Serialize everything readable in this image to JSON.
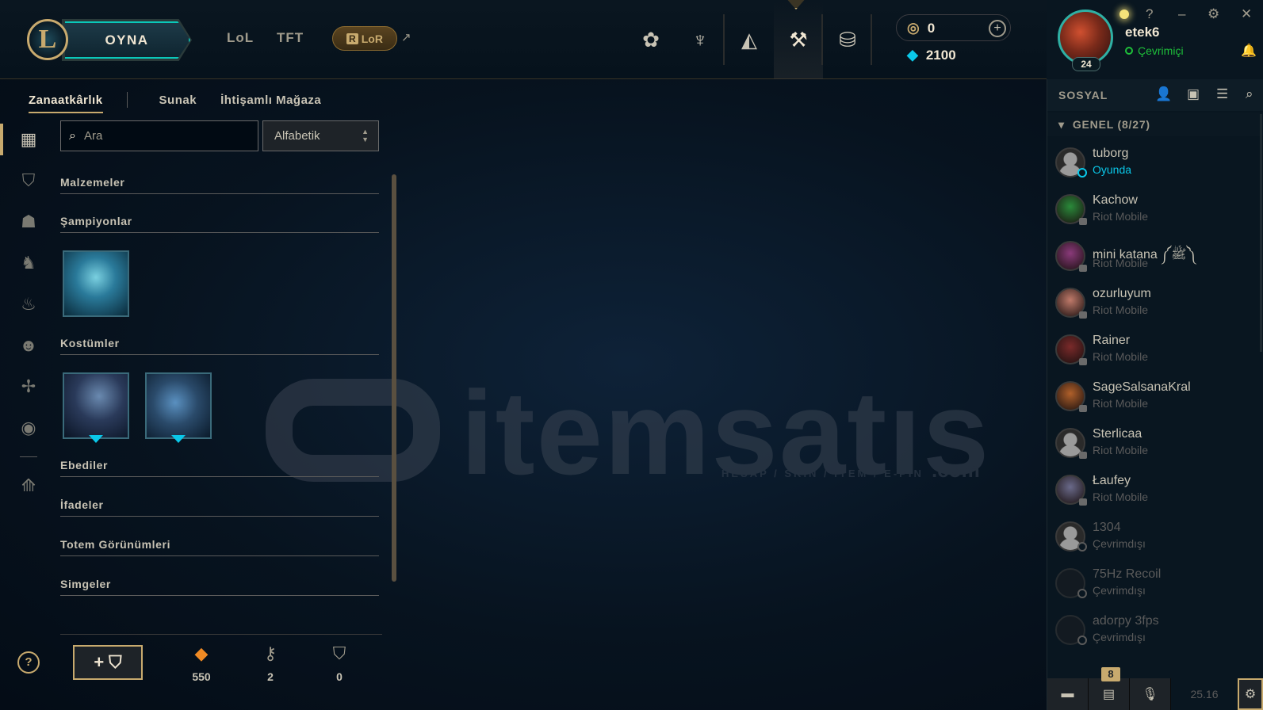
{
  "topnav": {
    "logo": "L",
    "play_label": "OYNA",
    "tabs": [
      "LoL",
      "TFT"
    ],
    "lor_label": "LoR",
    "lor_r": "R",
    "external_arrow": "↗",
    "nav_icons": [
      {
        "name": "home-icon",
        "glyph": "✿"
      },
      {
        "name": "tft-icon",
        "glyph": "♆"
      },
      {
        "name": "collection-icon",
        "glyph": "◭"
      },
      {
        "name": "loot-icon",
        "glyph": "⚒"
      },
      {
        "name": "store-icon",
        "glyph": "⛁"
      }
    ],
    "rp_value": "0",
    "be_value": "2100",
    "plus": "+"
  },
  "user": {
    "name": "etek6",
    "status": "Çevrimiçi",
    "level": "24",
    "controls": {
      "help": "?",
      "minimize": "–",
      "settings": "⚙",
      "close": "✕"
    }
  },
  "subtabs": {
    "items": [
      "Zanaatkârlık",
      "Sunak",
      "İhtişamlı Mağaza"
    ],
    "active": "Zanaatkârlık"
  },
  "sidebar": {
    "items": [
      {
        "name": "sidebar-all-icon",
        "glyph": "▦"
      },
      {
        "name": "sidebar-chest-icon",
        "glyph": "⛉"
      },
      {
        "name": "sidebar-champion-icon",
        "glyph": "☗"
      },
      {
        "name": "sidebar-skin-icon",
        "glyph": "♞"
      },
      {
        "name": "sidebar-ward-icon",
        "glyph": "♨"
      },
      {
        "name": "sidebar-emote-icon",
        "glyph": "☻"
      },
      {
        "name": "sidebar-eternals-icon",
        "glyph": "✢"
      },
      {
        "name": "sidebar-icon-icon",
        "glyph": "◉"
      },
      {
        "name": "sidebar-reroll-icon",
        "glyph": "⟰"
      }
    ]
  },
  "search": {
    "placeholder": "Ara",
    "icon": "⌕"
  },
  "sort": {
    "selected": "Alfabetik"
  },
  "categories": [
    "Malzemeler",
    "Şampiyonlar",
    "Kostümler",
    "Ebediler",
    "İfadeler",
    "Totem Görünümleri",
    "Simgeler"
  ],
  "bottom": {
    "add_key_plus": "+",
    "add_key_glyph": "⛉",
    "help": "?",
    "stats": [
      {
        "name": "orange-essence",
        "glyph": "◆",
        "color": "#f08a24",
        "value": "550"
      },
      {
        "name": "key-fragment",
        "glyph": "⚷",
        "color": "#a09b8c",
        "value": "2"
      },
      {
        "name": "chest",
        "glyph": "⛉",
        "color": "#a09b8c",
        "value": "0"
      }
    ]
  },
  "social": {
    "title": "SOSYAL",
    "group": "GENEL (8/27)",
    "friends": [
      {
        "name": "tuborg",
        "sub": "Oyunda",
        "state": "ingame",
        "avatar": "default"
      },
      {
        "name": "Kachow",
        "sub": "Riot Mobile",
        "state": "mobile",
        "avatar": "#2a8a3a"
      },
      {
        "name": "mini katana ༼ﷺ༽",
        "sub": "Riot Mobile",
        "state": "mobile",
        "avatar": "#8a3a7a"
      },
      {
        "name": "ozurluyum",
        "sub": "Riot Mobile",
        "state": "mobile",
        "avatar": "#c07a6a"
      },
      {
        "name": "Rainer",
        "sub": "Riot Mobile",
        "state": "mobile",
        "avatar": "#7a2a2a"
      },
      {
        "name": "SageSalsanaKral",
        "sub": "Riot Mobile",
        "state": "mobile",
        "avatar": "#b0602a"
      },
      {
        "name": "Sterlicaa",
        "sub": "Riot Mobile",
        "state": "mobile",
        "avatar": "default"
      },
      {
        "name": "Łaufey",
        "sub": "Riot Mobile",
        "state": "mobile",
        "avatar": "#6a6a8a"
      },
      {
        "name": "1304",
        "sub": "Çevrimdışı",
        "state": "off",
        "avatar": "default"
      },
      {
        "name": "75Hz Recoil",
        "sub": "Çevrimdışı",
        "state": "off",
        "avatar": "offline"
      },
      {
        "name": "adorpy 3fps",
        "sub": "Çevrimdışı",
        "state": "off",
        "avatar": "offline"
      }
    ],
    "badge": "8",
    "version": "25.16"
  },
  "watermark": {
    "text": "itemsatıs",
    "sub": "HESAP / SKIN / ITEM / E-PIN",
    "com": ".com"
  }
}
